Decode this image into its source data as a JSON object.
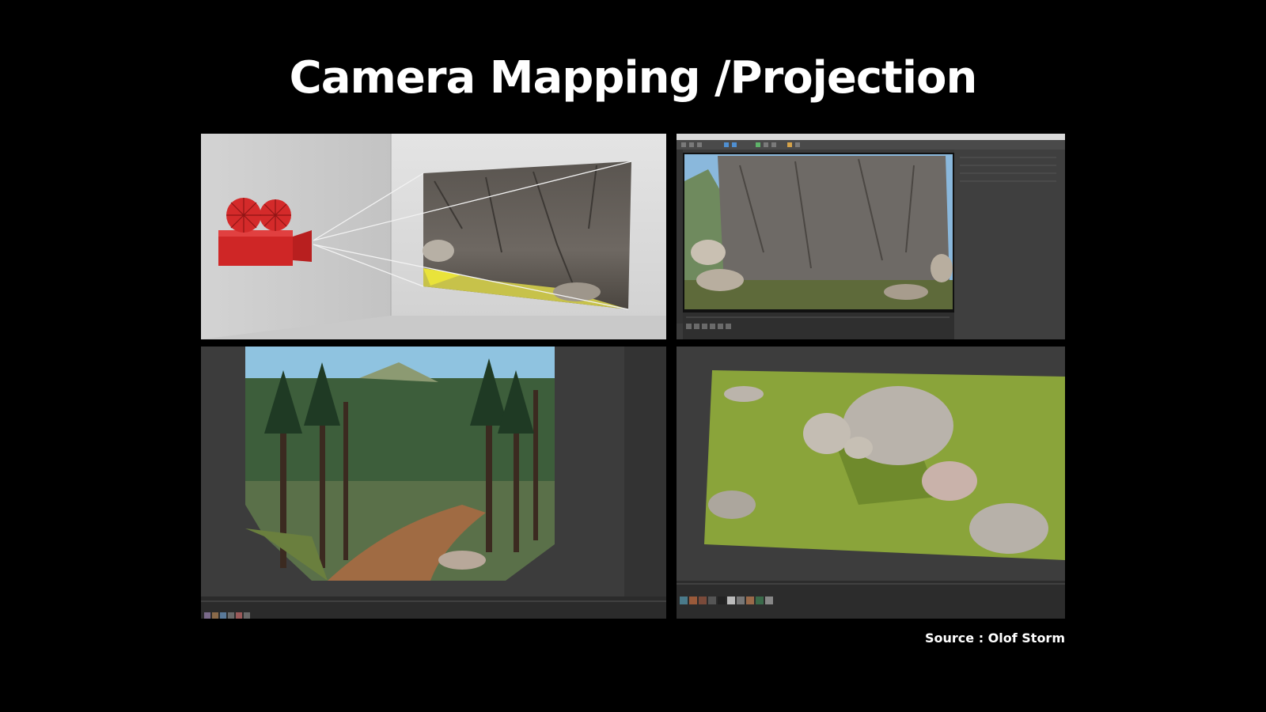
{
  "title": "Camera Mapping /Projection",
  "source_credit": "Source : Olof Storm",
  "panels": [
    {
      "id": "panel-camera-projection-diagram"
    },
    {
      "id": "panel-3d-app-rock-viewport"
    },
    {
      "id": "panel-forest-projection"
    },
    {
      "id": "panel-meadow-rocks-projection"
    }
  ],
  "colors": {
    "background": "#000000",
    "text": "#ffffff",
    "camera_red": "#d92b2b",
    "app_gray": "#3b3b3b"
  }
}
